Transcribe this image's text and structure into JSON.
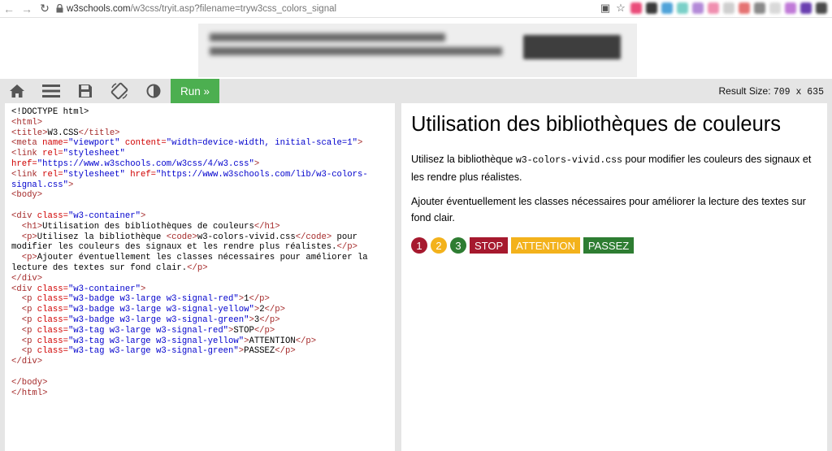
{
  "browser": {
    "url_host": "w3schools.com",
    "url_path": "/w3css/tryit.asp?filename=tryw3css_colors_signal",
    "extension_colors": [
      "#ea4c7a",
      "#3a3a3a",
      "#4fa3d9",
      "#7ad0c8",
      "#b38ad8",
      "#f08fb0",
      "#cfcfcf",
      "#e57373",
      "#8a8a8a",
      "#d9d9d9",
      "#c07ad8",
      "#6a3fb0",
      "#4a4a4a"
    ]
  },
  "toolbar": {
    "icons": [
      "home-icon",
      "menu-icon",
      "save-icon",
      "rotate-icon",
      "contrast-icon"
    ],
    "run_label": "Run »",
    "result_size_label": "Result Size:",
    "result_size_value": "709 x 635"
  },
  "code": {
    "lines": [
      [
        {
          "c": "tx",
          "t": "<!DOCTYPE html>"
        }
      ],
      [
        {
          "c": "tg",
          "t": "<html>"
        }
      ],
      [
        {
          "c": "tg",
          "t": "<title>"
        },
        {
          "c": "tx",
          "t": "W3.CSS"
        },
        {
          "c": "tg",
          "t": "</title>"
        }
      ],
      [
        {
          "c": "tg",
          "t": "<meta "
        },
        {
          "c": "at",
          "t": "name="
        },
        {
          "c": "vl",
          "t": "\"viewport\" "
        },
        {
          "c": "at",
          "t": "content="
        },
        {
          "c": "vl",
          "t": "\"width=device-width, initial-scale=1\""
        },
        {
          "c": "tg",
          "t": ">"
        }
      ],
      [
        {
          "c": "tg",
          "t": "<link "
        },
        {
          "c": "at",
          "t": "rel="
        },
        {
          "c": "vl",
          "t": "\"stylesheet\""
        }
      ],
      [
        {
          "c": "at",
          "t": "href="
        },
        {
          "c": "vl",
          "t": "\"https://www.w3schools.com/w3css/4/w3.css\""
        },
        {
          "c": "tg",
          "t": ">"
        }
      ],
      [
        {
          "c": "tg",
          "t": "<link "
        },
        {
          "c": "at",
          "t": "rel="
        },
        {
          "c": "vl",
          "t": "\"stylesheet\" "
        },
        {
          "c": "at",
          "t": "href="
        },
        {
          "c": "vl",
          "t": "\"https://www.w3schools.com/lib/w3-colors-"
        }
      ],
      [
        {
          "c": "vl",
          "t": "signal.css\""
        },
        {
          "c": "tg",
          "t": ">"
        }
      ],
      [
        {
          "c": "tg",
          "t": "<body>"
        }
      ],
      [
        {
          "c": "tx",
          "t": ""
        }
      ],
      [
        {
          "c": "tg",
          "t": "<div "
        },
        {
          "c": "at",
          "t": "class="
        },
        {
          "c": "vl",
          "t": "\"w3-container\""
        },
        {
          "c": "tg",
          "t": ">"
        }
      ],
      [
        {
          "c": "tx",
          "t": "  "
        },
        {
          "c": "tg",
          "t": "<h1>"
        },
        {
          "c": "tx",
          "t": "Utilisation des bibliothèques de couleurs"
        },
        {
          "c": "tg",
          "t": "</h1>"
        }
      ],
      [
        {
          "c": "tx",
          "t": "  "
        },
        {
          "c": "tg",
          "t": "<p>"
        },
        {
          "c": "tx",
          "t": "Utilisez la bibliothèque "
        },
        {
          "c": "tg",
          "t": "<code>"
        },
        {
          "c": "tx",
          "t": "w3-colors-vivid.css"
        },
        {
          "c": "tg",
          "t": "</code>"
        },
        {
          "c": "tx",
          "t": " pour"
        }
      ],
      [
        {
          "c": "tx",
          "t": "modifier les couleurs des signaux et les rendre plus réalistes."
        },
        {
          "c": "tg",
          "t": "</p>"
        }
      ],
      [
        {
          "c": "tx",
          "t": "  "
        },
        {
          "c": "tg",
          "t": "<p>"
        },
        {
          "c": "tx",
          "t": "Ajouter éventuellement les classes nécessaires pour améliorer la"
        }
      ],
      [
        {
          "c": "tx",
          "t": "lecture des textes sur fond clair."
        },
        {
          "c": "tg",
          "t": "</p>"
        }
      ],
      [
        {
          "c": "tg",
          "t": "</div>"
        }
      ],
      [
        {
          "c": "tg",
          "t": "<div "
        },
        {
          "c": "at",
          "t": "class="
        },
        {
          "c": "vl",
          "t": "\"w3-container\""
        },
        {
          "c": "tg",
          "t": ">"
        }
      ],
      [
        {
          "c": "tx",
          "t": "  "
        },
        {
          "c": "tg",
          "t": "<p "
        },
        {
          "c": "at",
          "t": "class="
        },
        {
          "c": "vl",
          "t": "\"w3-badge w3-large w3-signal-red\""
        },
        {
          "c": "tg",
          "t": ">"
        },
        {
          "c": "tx",
          "t": "1"
        },
        {
          "c": "tg",
          "t": "</p>"
        }
      ],
      [
        {
          "c": "tx",
          "t": "  "
        },
        {
          "c": "tg",
          "t": "<p "
        },
        {
          "c": "at",
          "t": "class="
        },
        {
          "c": "vl",
          "t": "\"w3-badge w3-large w3-signal-yellow\""
        },
        {
          "c": "tg",
          "t": ">"
        },
        {
          "c": "tx",
          "t": "2"
        },
        {
          "c": "tg",
          "t": "</p>"
        }
      ],
      [
        {
          "c": "tx",
          "t": "  "
        },
        {
          "c": "tg",
          "t": "<p "
        },
        {
          "c": "at",
          "t": "class="
        },
        {
          "c": "vl",
          "t": "\"w3-badge w3-large w3-signal-green\""
        },
        {
          "c": "tg",
          "t": ">"
        },
        {
          "c": "tx",
          "t": "3"
        },
        {
          "c": "tg",
          "t": "</p>"
        }
      ],
      [
        {
          "c": "tx",
          "t": "  "
        },
        {
          "c": "tg",
          "t": "<p "
        },
        {
          "c": "at",
          "t": "class="
        },
        {
          "c": "vl",
          "t": "\"w3-tag w3-large w3-signal-red\""
        },
        {
          "c": "tg",
          "t": ">"
        },
        {
          "c": "tx",
          "t": "STOP"
        },
        {
          "c": "tg",
          "t": "</p>"
        }
      ],
      [
        {
          "c": "tx",
          "t": "  "
        },
        {
          "c": "tg",
          "t": "<p "
        },
        {
          "c": "at",
          "t": "class="
        },
        {
          "c": "vl",
          "t": "\"w3-tag w3-large w3-signal-yellow\""
        },
        {
          "c": "tg",
          "t": ">"
        },
        {
          "c": "tx",
          "t": "ATTENTION"
        },
        {
          "c": "tg",
          "t": "</p>"
        }
      ],
      [
        {
          "c": "tx",
          "t": "  "
        },
        {
          "c": "tg",
          "t": "<p "
        },
        {
          "c": "at",
          "t": "class="
        },
        {
          "c": "vl",
          "t": "\"w3-tag w3-large w3-signal-green\""
        },
        {
          "c": "tg",
          "t": ">"
        },
        {
          "c": "tx",
          "t": "PASSEZ"
        },
        {
          "c": "tg",
          "t": "</p>"
        }
      ],
      [
        {
          "c": "tg",
          "t": "</div>"
        }
      ],
      [
        {
          "c": "tx",
          "t": ""
        }
      ],
      [
        {
          "c": "tg",
          "t": "</body>"
        }
      ],
      [
        {
          "c": "tg",
          "t": "</html>"
        }
      ]
    ]
  },
  "result": {
    "heading": "Utilisation des bibliothèques de couleurs",
    "p1_before": "Utilisez la bibliothèque ",
    "p1_code": "w3-colors-vivid.css",
    "p1_after": " pour modifier les couleurs des signaux et les rendre plus réalistes.",
    "p2": "Ajouter éventuellement les classes nécessaires pour améliorer la lecture des textes sur fond clair.",
    "badges": [
      {
        "label": "1",
        "color": "red"
      },
      {
        "label": "2",
        "color": "yellow"
      },
      {
        "label": "3",
        "color": "green"
      }
    ],
    "tags": [
      {
        "label": "STOP",
        "color": "red"
      },
      {
        "label": "ATTENTION",
        "color": "yellow"
      },
      {
        "label": "PASSEZ",
        "color": "green"
      }
    ],
    "signal_colors": {
      "red": "#a6192e",
      "yellow": "#f3b21c",
      "green": "#2e7d32"
    },
    "run_button_color": "#4caf50"
  }
}
